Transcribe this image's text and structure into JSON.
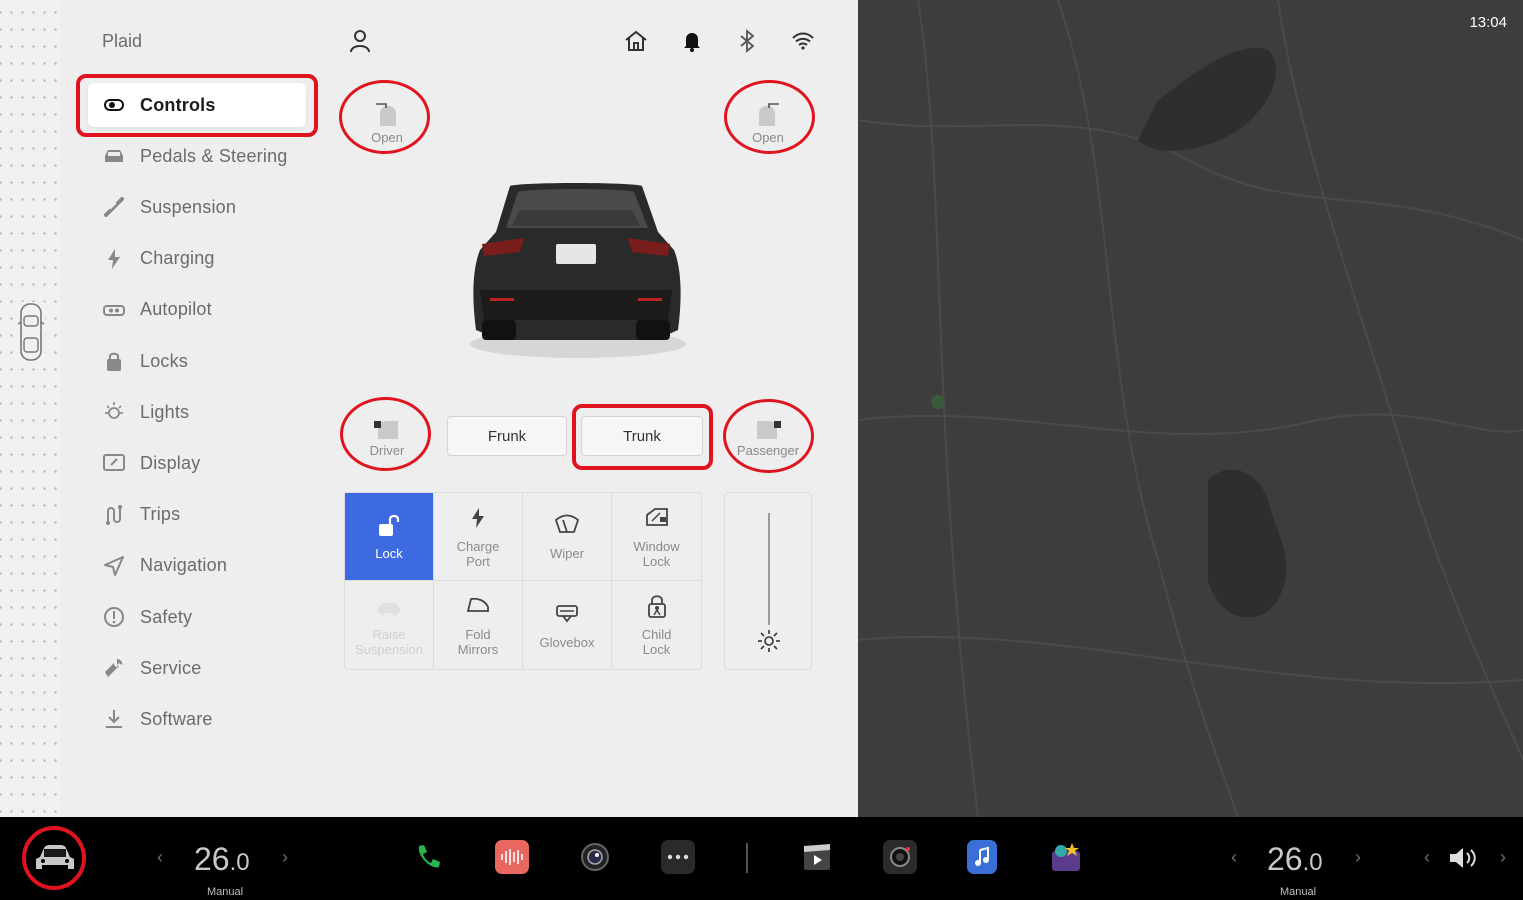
{
  "brand": "Plaid",
  "clock": "13:04",
  "menu": [
    {
      "label": "Controls",
      "icon": "toggle-icon",
      "active": true
    },
    {
      "label": "Pedals & Steering",
      "icon": "car-front-icon"
    },
    {
      "label": "Suspension",
      "icon": "suspension-icon"
    },
    {
      "label": "Charging",
      "icon": "lightning-icon"
    },
    {
      "label": "Autopilot",
      "icon": "steering-wheel-icon"
    },
    {
      "label": "Locks",
      "icon": "lock-icon"
    },
    {
      "label": "Lights",
      "icon": "light-icon"
    },
    {
      "label": "Display",
      "icon": "display-icon"
    },
    {
      "label": "Trips",
      "icon": "trips-icon"
    },
    {
      "label": "Navigation",
      "icon": "navigation-icon"
    },
    {
      "label": "Safety",
      "icon": "safety-icon"
    },
    {
      "label": "Service",
      "icon": "wrench-icon"
    },
    {
      "label": "Software",
      "icon": "download-icon"
    }
  ],
  "doors": {
    "front_left": "Open",
    "front_right": "Open",
    "driver": "Driver",
    "passenger": "Passenger"
  },
  "buttons": {
    "frunk": "Frunk",
    "trunk": "Trunk"
  },
  "controls": [
    {
      "label": "Lock",
      "icon": "unlock-icon",
      "state": "active"
    },
    {
      "label": "Charge\nPort",
      "icon": "lightning-icon"
    },
    {
      "label": "Wiper",
      "icon": "wiper-icon"
    },
    {
      "label": "Window\nLock",
      "icon": "window-lock-icon"
    },
    {
      "label": "Raise\nSuspension",
      "icon": "raise-suspension-icon",
      "state": "disabled"
    },
    {
      "label": "Fold\nMirrors",
      "icon": "mirror-icon"
    },
    {
      "label": "Glovebox",
      "icon": "glovebox-icon"
    },
    {
      "label": "Child\nLock",
      "icon": "child-lock-icon"
    }
  ],
  "bottom_bar": {
    "driver_temp_whole": "26",
    "driver_temp_decimal": ".0",
    "driver_mode": "Manual",
    "passenger_temp_whole": "26",
    "passenger_temp_decimal": ".0",
    "passenger_mode": "Manual",
    "dock": [
      "phone-icon",
      "audio-icon",
      "camera-icon",
      "more-icon",
      "theater-icon",
      "dashcam-icon",
      "music-icon",
      "toybox-icon"
    ]
  },
  "colors": {
    "highlight": "#e0141e",
    "accent": "#3e6ae1"
  }
}
